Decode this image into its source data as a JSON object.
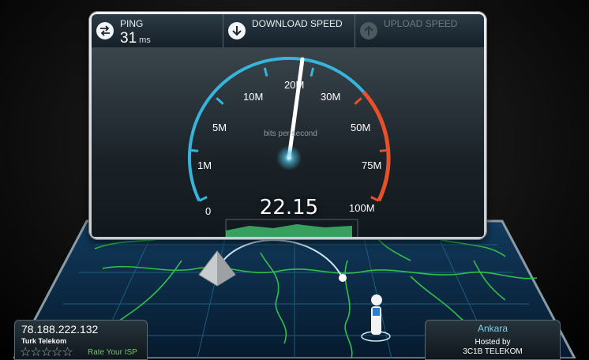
{
  "header": {
    "ping": {
      "label": "PING",
      "value": "31",
      "unit": "ms"
    },
    "download": {
      "label": "DOWNLOAD SPEED"
    },
    "upload": {
      "label": "UPLOAD SPEED"
    }
  },
  "gauge": {
    "ticks": [
      "0",
      "1M",
      "5M",
      "10M",
      "20M",
      "30M",
      "50M",
      "75M",
      "100M"
    ],
    "unit_label": "bits per second",
    "reading": "22.15"
  },
  "client": {
    "ip": "78.188.222.132",
    "isp": "Turk Telekom",
    "rating_stars": 5,
    "rate_label": "Rate Your ISP"
  },
  "server": {
    "city": "Ankara",
    "hosted_by_label": "Hosted by",
    "host": "3C1B TELEKOM"
  },
  "colors": {
    "gauge_arc": "#35b5dc",
    "gauge_high": "#e8502a",
    "grid": "#2aa8c8",
    "graph": "#3fb86a"
  }
}
